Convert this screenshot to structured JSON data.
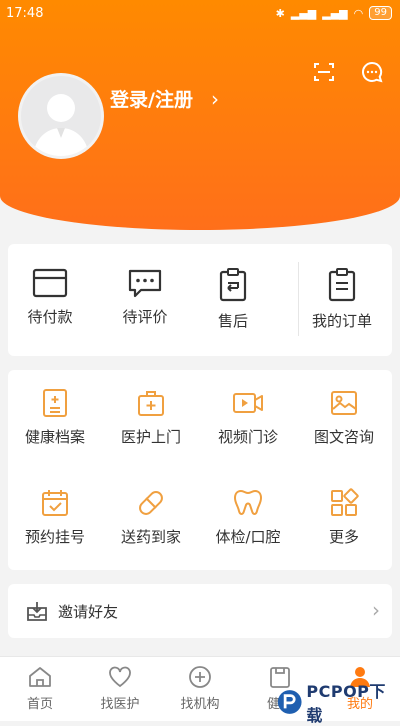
{
  "status_bar": {
    "time": "17:48",
    "battery": "99"
  },
  "profile": {
    "login_label": "登录/注册",
    "chevron": "›"
  },
  "orders": {
    "items": [
      {
        "label": "待付款",
        "icon": "card-icon"
      },
      {
        "label": "待评价",
        "icon": "comment-icon"
      },
      {
        "label": "售后",
        "icon": "return-icon"
      }
    ],
    "all_label": "我的订单"
  },
  "services": [
    {
      "label": "健康档案",
      "icon": "health-record-icon"
    },
    {
      "label": "医护上门",
      "icon": "medical-kit-icon"
    },
    {
      "label": "视频门诊",
      "icon": "video-icon"
    },
    {
      "label": "图文咨询",
      "icon": "image-chat-icon"
    },
    {
      "label": "预约挂号",
      "icon": "calendar-icon"
    },
    {
      "label": "送药到家",
      "icon": "pill-icon"
    },
    {
      "label": "体检/口腔",
      "icon": "tooth-icon"
    },
    {
      "label": "更多",
      "icon": "grid-icon"
    }
  ],
  "invite": {
    "label": "邀请好友",
    "chevron": "›"
  },
  "tabs": [
    {
      "label": "首页"
    },
    {
      "label": "找医护"
    },
    {
      "label": "找机构"
    },
    {
      "label": "健康"
    },
    {
      "label": "我的"
    }
  ],
  "watermark": {
    "text": "PCPOP下载"
  },
  "colors": {
    "accent": "#ff7a10",
    "icon_orange": "#f0a040",
    "dark_icon": "#333333"
  }
}
